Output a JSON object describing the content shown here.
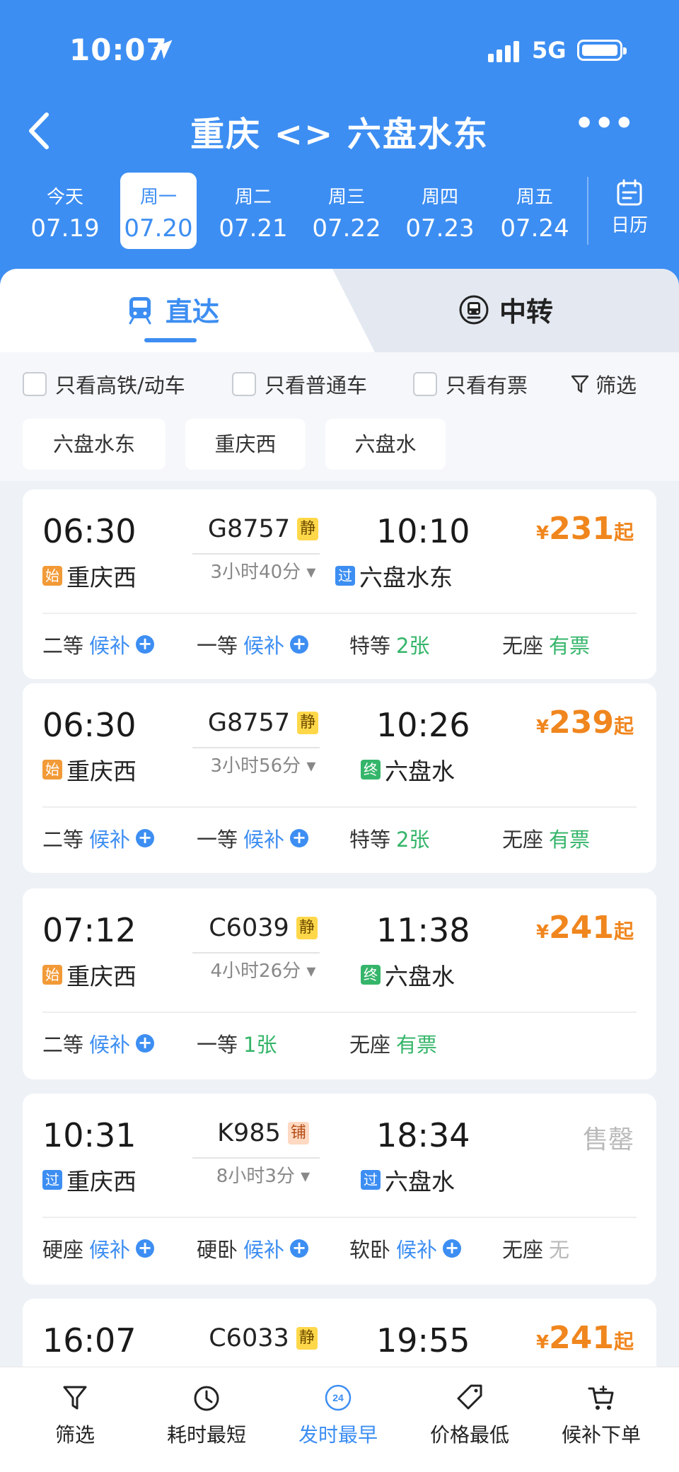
{
  "status_bar": {
    "time": "10:07",
    "network": "5G"
  },
  "header": {
    "title": "重庆 <> 六盘水东",
    "dates": [
      {
        "dow": "今天",
        "date": "07.19",
        "selected": false
      },
      {
        "dow": "周一",
        "date": "07.20",
        "selected": true
      },
      {
        "dow": "周二",
        "date": "07.21",
        "selected": false
      },
      {
        "dow": "周三",
        "date": "07.22",
        "selected": false
      },
      {
        "dow": "周四",
        "date": "07.23",
        "selected": false
      },
      {
        "dow": "周五",
        "date": "07.24",
        "selected": false
      }
    ],
    "calendar_label": "日历"
  },
  "tabs": {
    "direct": "直达",
    "transfer": "中转"
  },
  "filters": {
    "checkboxes": [
      "只看高铁/动车",
      "只看普通车",
      "只看有票"
    ],
    "screen_label": "筛选",
    "stations": [
      "六盘水东",
      "重庆西",
      "六盘水"
    ]
  },
  "trains": [
    {
      "dep_time": "06:30",
      "train_no": "G8757",
      "tag": "静",
      "duration": "3小时40分",
      "arr_time": "10:10",
      "from_badge": "始",
      "from": "重庆西",
      "to_badge": "过",
      "to": "六盘水东",
      "price_symbol": "¥",
      "price": "231",
      "price_suffix": "起",
      "seats": [
        {
          "class": "二等",
          "status": "候补",
          "kind": "waitlist"
        },
        {
          "class": "一等",
          "status": "候补",
          "kind": "waitlist"
        },
        {
          "class": "特等",
          "status": "2张",
          "kind": "available"
        },
        {
          "class": "无座",
          "status": "有票",
          "kind": "available"
        }
      ]
    },
    {
      "dep_time": "06:30",
      "train_no": "G8757",
      "tag": "静",
      "duration": "3小时56分",
      "arr_time": "10:26",
      "from_badge": "始",
      "from": "重庆西",
      "to_badge": "终",
      "to": "六盘水",
      "price_symbol": "¥",
      "price": "239",
      "price_suffix": "起",
      "seats": [
        {
          "class": "二等",
          "status": "候补",
          "kind": "waitlist"
        },
        {
          "class": "一等",
          "status": "候补",
          "kind": "waitlist"
        },
        {
          "class": "特等",
          "status": "2张",
          "kind": "available"
        },
        {
          "class": "无座",
          "status": "有票",
          "kind": "available"
        }
      ]
    },
    {
      "dep_time": "07:12",
      "train_no": "C6039",
      "tag": "静",
      "duration": "4小时26分",
      "arr_time": "11:38",
      "from_badge": "始",
      "from": "重庆西",
      "to_badge": "终",
      "to": "六盘水",
      "price_symbol": "¥",
      "price": "241",
      "price_suffix": "起",
      "seats": [
        {
          "class": "二等",
          "status": "候补",
          "kind": "waitlist"
        },
        {
          "class": "一等",
          "status": "1张",
          "kind": "available"
        },
        {
          "class": "无座",
          "status": "有票",
          "kind": "available"
        }
      ]
    },
    {
      "dep_time": "10:31",
      "train_no": "K985",
      "tag": "铺",
      "duration": "8小时3分",
      "arr_time": "18:34",
      "from_badge": "过",
      "from": "重庆西",
      "to_badge": "过",
      "to": "六盘水",
      "sold_out": "售罄",
      "seats": [
        {
          "class": "硬座",
          "status": "候补",
          "kind": "waitlist"
        },
        {
          "class": "硬卧",
          "status": "候补",
          "kind": "waitlist"
        },
        {
          "class": "软卧",
          "status": "候补",
          "kind": "waitlist"
        },
        {
          "class": "无座",
          "status": "无",
          "kind": "none"
        }
      ]
    },
    {
      "dep_time": "16:07",
      "train_no": "C6033",
      "tag": "静",
      "arr_time": "19:55",
      "price_symbol": "¥",
      "price": "241",
      "price_suffix": "起"
    }
  ],
  "bottom_bar": [
    {
      "label": "筛选",
      "icon": "filter-icon"
    },
    {
      "label": "耗时最短",
      "icon": "clock-icon"
    },
    {
      "label": "发时最早",
      "icon": "earliest-24-icon",
      "active": true,
      "badge": "24"
    },
    {
      "label": "价格最低",
      "icon": "price-tag-icon"
    },
    {
      "label": "候补下单",
      "icon": "cart-icon"
    }
  ],
  "colors": {
    "primary": "#3d8ef2",
    "price": "#f0861e",
    "available": "#35b56a",
    "muted": "#b9b9b9"
  }
}
